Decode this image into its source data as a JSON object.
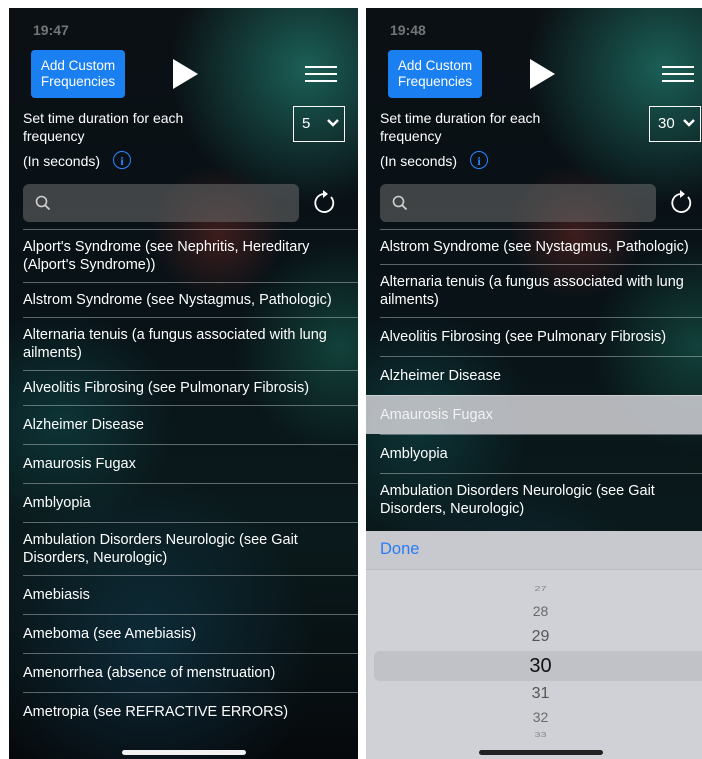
{
  "left": {
    "status_time": "19:47",
    "add_button_label": "Add Custom Frequencies",
    "duration_label": "Set time duration for each frequency",
    "seconds_label": "(In seconds)",
    "info_glyph": "i",
    "duration_value": "5",
    "search_placeholder": "",
    "items": [
      "Alport's Syndrome (see Nephritis, Hereditary (Alport's Syndrome))",
      "Alstrom Syndrome (see Nystagmus, Pathologic)",
      "Alternaria tenuis (a fungus associated with lung ailments)",
      "Alveolitis Fibrosing (see Pulmonary Fibrosis)",
      "Alzheimer Disease",
      "Amaurosis Fugax",
      "Amblyopia",
      "Ambulation Disorders Neurologic (see Gait Disorders, Neurologic)",
      "Amebiasis",
      "Ameboma (see Amebiasis)",
      "Amenorrhea (absence of menstruation)",
      "Ametropia (see REFRACTIVE ERRORS)"
    ]
  },
  "right": {
    "status_time": "19:48",
    "add_button_label": "Add Custom Frequencies",
    "duration_label": "Set time duration for each frequency",
    "seconds_label": "(In seconds)",
    "info_glyph": "i",
    "duration_value": "30",
    "search_placeholder": "",
    "items": [
      "Alstrom Syndrome (see Nystagmus, Pathologic)",
      "Alternaria tenuis (a fungus associated with lung ailments)",
      "Alveolitis Fibrosing (see Pulmonary Fibrosis)",
      "Alzheimer Disease",
      "Amaurosis Fugax",
      "Amblyopia",
      "Ambulation Disorders Neurologic (see Gait Disorders, Neurologic)"
    ],
    "selected_item": "Amaurosis Fugax",
    "picker": {
      "done_label": "Done",
      "values": [
        "27",
        "28",
        "29",
        "30",
        "31",
        "32",
        "33"
      ],
      "selected": "30"
    }
  },
  "colors": {
    "accent_blue": "#1a7ff0",
    "picker_bg": "#cfd1d6",
    "done_blue": "#2a7cf4"
  },
  "icons": [
    "play-icon",
    "menu-icon",
    "info-icon",
    "chevron-down-icon",
    "search-icon",
    "refresh-icon"
  ]
}
